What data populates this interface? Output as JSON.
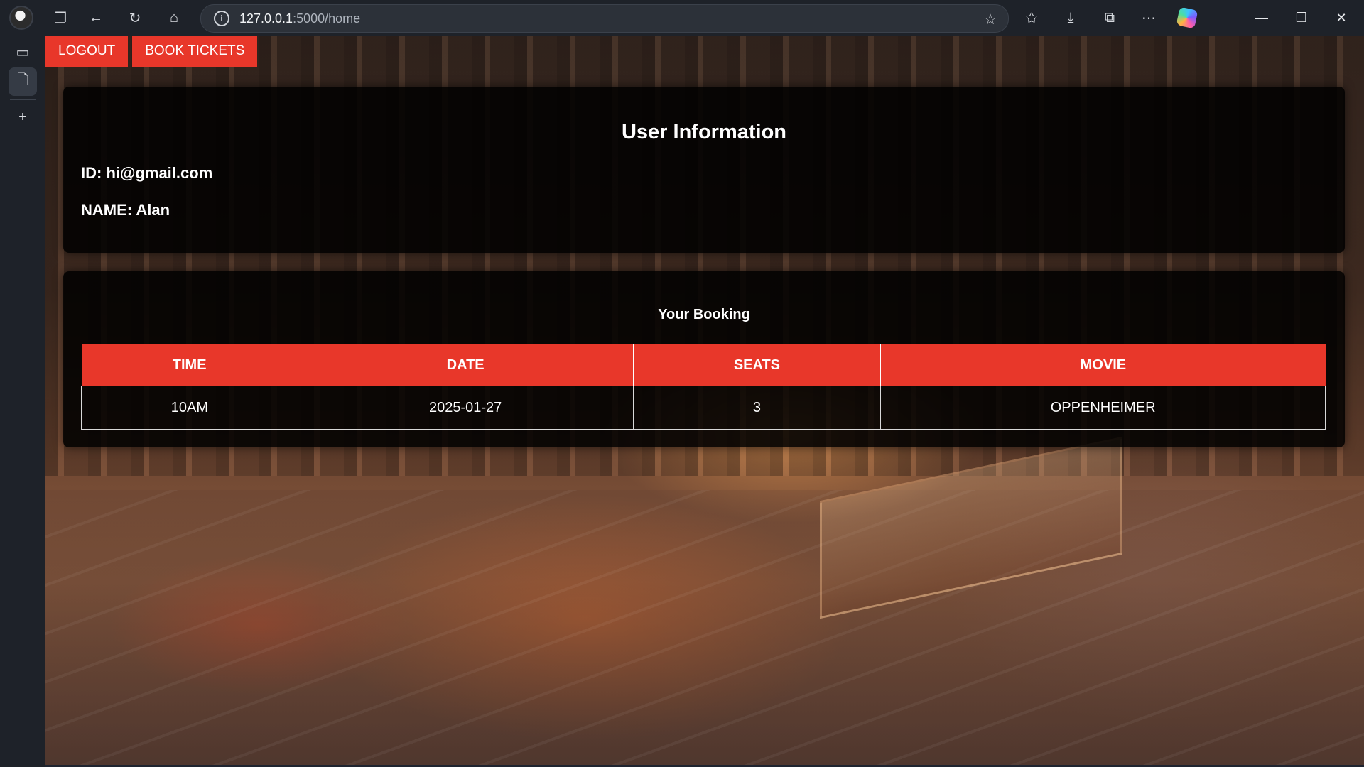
{
  "browser": {
    "url_host": "127.0.0.1",
    "url_path": ":5000/home"
  },
  "nav": {
    "logout_label": "LOGOUT",
    "book_label": "BOOK TICKETS"
  },
  "user_info": {
    "title": "User Information",
    "id_line": "ID: hi@gmail.com",
    "name_line": "NAME: Alan"
  },
  "booking": {
    "title": "Your Booking",
    "columns": [
      "TIME",
      "DATE",
      "SEATS",
      "MOVIE"
    ],
    "rows": [
      [
        "10AM",
        "2025-01-27",
        "3",
        "OPPENHEIMER"
      ]
    ]
  },
  "colors": {
    "accent": "#e8372a",
    "panel_bg": "#000000"
  }
}
